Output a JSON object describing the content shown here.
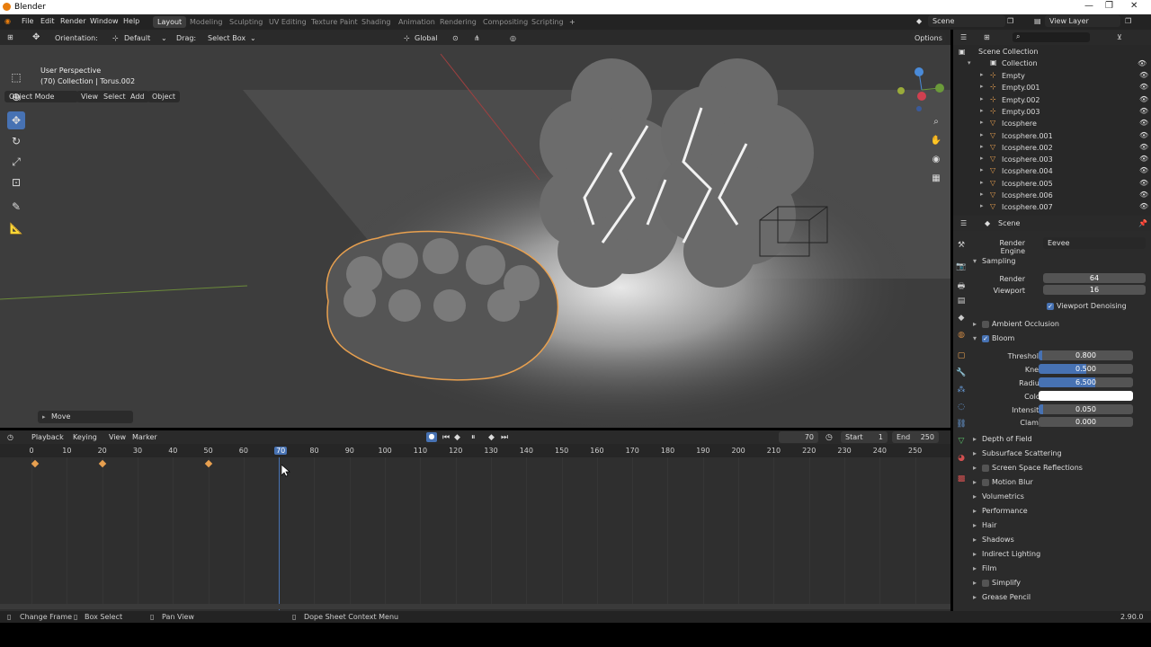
{
  "window": {
    "title": "Blender"
  },
  "menu": [
    "File",
    "Edit",
    "Render",
    "Window",
    "Help"
  ],
  "workspaces": [
    "Layout",
    "Modeling",
    "Sculpting",
    "UV Editing",
    "Texture Paint",
    "Shading",
    "Animation",
    "Rendering",
    "Compositing",
    "Scripting"
  ],
  "active_workspace": "Layout",
  "scene_field": "Scene",
  "view_layer_field": "View Layer",
  "tool_header": {
    "orientation_label": "Orientation:",
    "orientation_value": "Default",
    "drag_label": "Drag:",
    "drag_value": "Select Box",
    "transform_orientation": "Global",
    "options": "Options"
  },
  "viewport": {
    "mode": "Object Mode",
    "menus": [
      "View",
      "Select",
      "Add",
      "Object"
    ],
    "overlay_title": "User Perspective",
    "overlay_subtitle": "(70) Collection | Torus.002",
    "last_op": "Move"
  },
  "outliner": {
    "root": "Scene Collection",
    "collection": "Collection",
    "items": [
      "Empty",
      "Empty.001",
      "Empty.002",
      "Empty.003",
      "Icosphere",
      "Icosphere.001",
      "Icosphere.002",
      "Icosphere.003",
      "Icosphere.004",
      "Icosphere.005",
      "Icosphere.006",
      "Icosphere.007"
    ]
  },
  "properties": {
    "context": "Scene",
    "render_engine_label": "Render Engine",
    "render_engine": "Eevee",
    "sampling": {
      "title": "Sampling",
      "render_label": "Render",
      "render_value": "64",
      "viewport_label": "Viewport",
      "viewport_value": "16",
      "denoise_label": "Viewport Denoising",
      "denoise": true
    },
    "ambient_occlusion": "Ambient Occlusion",
    "bloom": {
      "title": "Bloom",
      "enabled": true,
      "threshold_label": "Threshold",
      "threshold": "0.800",
      "threshold_frac": 0.04,
      "knee_label": "Knee",
      "knee": "0.500",
      "knee_frac": 0.5,
      "radius_label": "Radius",
      "radius": "6.500",
      "radius_frac": 0.6,
      "color_label": "Color",
      "color": "#ffffff",
      "intensity_label": "Intensity",
      "intensity": "0.050",
      "intensity_frac": 0.05,
      "clamp_label": "Clamp",
      "clamp": "0.000",
      "clamp_frac": 0.0
    },
    "panels": [
      "Depth of Field",
      "Subsurface Scattering",
      "Screen Space Reflections",
      "Motion Blur",
      "Volumetrics",
      "Performance",
      "Hair",
      "Shadows",
      "Indirect Lighting",
      "Film",
      "Simplify",
      "Grease Pencil"
    ]
  },
  "timeline": {
    "menus": [
      "Playback",
      "Keying",
      "View",
      "Marker"
    ],
    "current_frame": "70",
    "start_label": "Start",
    "start": "1",
    "end_label": "End",
    "end": "250",
    "ticks": [
      "0",
      "10",
      "20",
      "30",
      "40",
      "50",
      "60",
      "70",
      "80",
      "90",
      "100",
      "110",
      "120",
      "130",
      "140",
      "150",
      "160",
      "170",
      "180",
      "190",
      "200",
      "210",
      "220",
      "230",
      "240",
      "250"
    ],
    "keyframes": [
      1,
      20,
      50
    ]
  },
  "status": {
    "items": [
      "Change Frame",
      "Box Select",
      "Pan View",
      "Dope Sheet Context Menu"
    ],
    "version": "2.90.0"
  },
  "colors": {
    "accent": "#4772b3",
    "selection": "#e8a04f",
    "background": "#3d3d3d"
  }
}
